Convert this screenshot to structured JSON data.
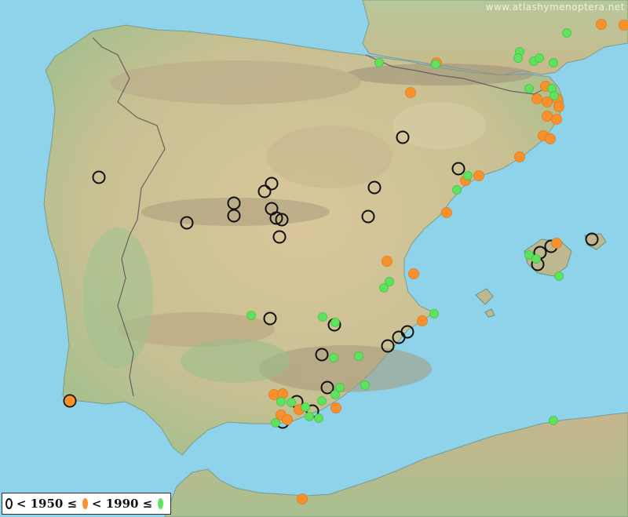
{
  "watermark": "www.atlashymenoptera.net",
  "legend": {
    "label_1950": "< 1950 ≤",
    "label_1990": "< 1990 ≤",
    "symbols": [
      "open-circle-icon",
      "orange-dot-icon",
      "green-dot-icon"
    ]
  },
  "colors": {
    "sea": "#8fd3ea",
    "land": "#c8c79a",
    "highland": "#b8a978",
    "lowland": "#9fc28f",
    "border": "#6b5f60",
    "record_pre_1950": "#111111",
    "record_1950_1990": "#f7902d",
    "record_post_1990": "#5fe35f"
  }
}
